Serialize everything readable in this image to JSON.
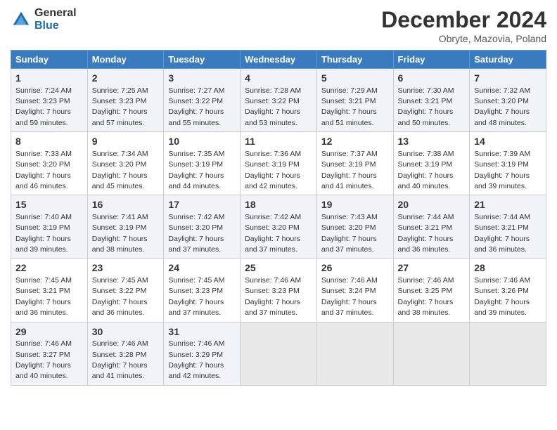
{
  "header": {
    "logo_general": "General",
    "logo_blue": "Blue",
    "month_title": "December 2024",
    "location": "Obryte, Mazovia, Poland"
  },
  "days_of_week": [
    "Sunday",
    "Monday",
    "Tuesday",
    "Wednesday",
    "Thursday",
    "Friday",
    "Saturday"
  ],
  "weeks": [
    [
      {
        "day": "1",
        "sunrise": "Sunrise: 7:24 AM",
        "sunset": "Sunset: 3:23 PM",
        "daylight": "Daylight: 7 hours and 59 minutes."
      },
      {
        "day": "2",
        "sunrise": "Sunrise: 7:25 AM",
        "sunset": "Sunset: 3:23 PM",
        "daylight": "Daylight: 7 hours and 57 minutes."
      },
      {
        "day": "3",
        "sunrise": "Sunrise: 7:27 AM",
        "sunset": "Sunset: 3:22 PM",
        "daylight": "Daylight: 7 hours and 55 minutes."
      },
      {
        "day": "4",
        "sunrise": "Sunrise: 7:28 AM",
        "sunset": "Sunset: 3:22 PM",
        "daylight": "Daylight: 7 hours and 53 minutes."
      },
      {
        "day": "5",
        "sunrise": "Sunrise: 7:29 AM",
        "sunset": "Sunset: 3:21 PM",
        "daylight": "Daylight: 7 hours and 51 minutes."
      },
      {
        "day": "6",
        "sunrise": "Sunrise: 7:30 AM",
        "sunset": "Sunset: 3:21 PM",
        "daylight": "Daylight: 7 hours and 50 minutes."
      },
      {
        "day": "7",
        "sunrise": "Sunrise: 7:32 AM",
        "sunset": "Sunset: 3:20 PM",
        "daylight": "Daylight: 7 hours and 48 minutes."
      }
    ],
    [
      {
        "day": "8",
        "sunrise": "Sunrise: 7:33 AM",
        "sunset": "Sunset: 3:20 PM",
        "daylight": "Daylight: 7 hours and 46 minutes."
      },
      {
        "day": "9",
        "sunrise": "Sunrise: 7:34 AM",
        "sunset": "Sunset: 3:20 PM",
        "daylight": "Daylight: 7 hours and 45 minutes."
      },
      {
        "day": "10",
        "sunrise": "Sunrise: 7:35 AM",
        "sunset": "Sunset: 3:19 PM",
        "daylight": "Daylight: 7 hours and 44 minutes."
      },
      {
        "day": "11",
        "sunrise": "Sunrise: 7:36 AM",
        "sunset": "Sunset: 3:19 PM",
        "daylight": "Daylight: 7 hours and 42 minutes."
      },
      {
        "day": "12",
        "sunrise": "Sunrise: 7:37 AM",
        "sunset": "Sunset: 3:19 PM",
        "daylight": "Daylight: 7 hours and 41 minutes."
      },
      {
        "day": "13",
        "sunrise": "Sunrise: 7:38 AM",
        "sunset": "Sunset: 3:19 PM",
        "daylight": "Daylight: 7 hours and 40 minutes."
      },
      {
        "day": "14",
        "sunrise": "Sunrise: 7:39 AM",
        "sunset": "Sunset: 3:19 PM",
        "daylight": "Daylight: 7 hours and 39 minutes."
      }
    ],
    [
      {
        "day": "15",
        "sunrise": "Sunrise: 7:40 AM",
        "sunset": "Sunset: 3:19 PM",
        "daylight": "Daylight: 7 hours and 39 minutes."
      },
      {
        "day": "16",
        "sunrise": "Sunrise: 7:41 AM",
        "sunset": "Sunset: 3:19 PM",
        "daylight": "Daylight: 7 hours and 38 minutes."
      },
      {
        "day": "17",
        "sunrise": "Sunrise: 7:42 AM",
        "sunset": "Sunset: 3:20 PM",
        "daylight": "Daylight: 7 hours and 37 minutes."
      },
      {
        "day": "18",
        "sunrise": "Sunrise: 7:42 AM",
        "sunset": "Sunset: 3:20 PM",
        "daylight": "Daylight: 7 hours and 37 minutes."
      },
      {
        "day": "19",
        "sunrise": "Sunrise: 7:43 AM",
        "sunset": "Sunset: 3:20 PM",
        "daylight": "Daylight: 7 hours and 37 minutes."
      },
      {
        "day": "20",
        "sunrise": "Sunrise: 7:44 AM",
        "sunset": "Sunset: 3:21 PM",
        "daylight": "Daylight: 7 hours and 36 minutes."
      },
      {
        "day": "21",
        "sunrise": "Sunrise: 7:44 AM",
        "sunset": "Sunset: 3:21 PM",
        "daylight": "Daylight: 7 hours and 36 minutes."
      }
    ],
    [
      {
        "day": "22",
        "sunrise": "Sunrise: 7:45 AM",
        "sunset": "Sunset: 3:21 PM",
        "daylight": "Daylight: 7 hours and 36 minutes."
      },
      {
        "day": "23",
        "sunrise": "Sunrise: 7:45 AM",
        "sunset": "Sunset: 3:22 PM",
        "daylight": "Daylight: 7 hours and 36 minutes."
      },
      {
        "day": "24",
        "sunrise": "Sunrise: 7:45 AM",
        "sunset": "Sunset: 3:23 PM",
        "daylight": "Daylight: 7 hours and 37 minutes."
      },
      {
        "day": "25",
        "sunrise": "Sunrise: 7:46 AM",
        "sunset": "Sunset: 3:23 PM",
        "daylight": "Daylight: 7 hours and 37 minutes."
      },
      {
        "day": "26",
        "sunrise": "Sunrise: 7:46 AM",
        "sunset": "Sunset: 3:24 PM",
        "daylight": "Daylight: 7 hours and 37 minutes."
      },
      {
        "day": "27",
        "sunrise": "Sunrise: 7:46 AM",
        "sunset": "Sunset: 3:25 PM",
        "daylight": "Daylight: 7 hours and 38 minutes."
      },
      {
        "day": "28",
        "sunrise": "Sunrise: 7:46 AM",
        "sunset": "Sunset: 3:26 PM",
        "daylight": "Daylight: 7 hours and 39 minutes."
      }
    ],
    [
      {
        "day": "29",
        "sunrise": "Sunrise: 7:46 AM",
        "sunset": "Sunset: 3:27 PM",
        "daylight": "Daylight: 7 hours and 40 minutes."
      },
      {
        "day": "30",
        "sunrise": "Sunrise: 7:46 AM",
        "sunset": "Sunset: 3:28 PM",
        "daylight": "Daylight: 7 hours and 41 minutes."
      },
      {
        "day": "31",
        "sunrise": "Sunrise: 7:46 AM",
        "sunset": "Sunset: 3:29 PM",
        "daylight": "Daylight: 7 hours and 42 minutes."
      },
      null,
      null,
      null,
      null
    ]
  ]
}
